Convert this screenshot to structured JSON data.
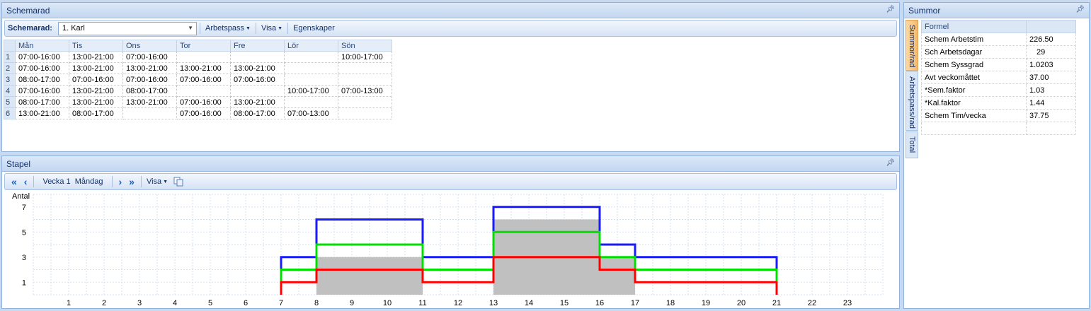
{
  "schemarad": {
    "title": "Schemarad",
    "toolbar": {
      "label": "Schemarad:",
      "combo_value": "1. Karl",
      "arbetspass": "Arbetspass",
      "visa": "Visa",
      "egenskaper": "Egenskaper"
    },
    "columns": [
      "Mån",
      "Tis",
      "Ons",
      "Tor",
      "Fre",
      "Lör",
      "Sön"
    ],
    "rows": [
      {
        "n": "1",
        "cells": [
          "07:00-16:00",
          "13:00-21:00",
          "07:00-16:00",
          "",
          "",
          "",
          "10:00-17:00"
        ]
      },
      {
        "n": "2",
        "cells": [
          "07:00-16:00",
          "13:00-21:00",
          "13:00-21:00",
          "13:00-21:00",
          "13:00-21:00",
          "",
          ""
        ]
      },
      {
        "n": "3",
        "cells": [
          "08:00-17:00",
          "07:00-16:00",
          "07:00-16:00",
          "07:00-16:00",
          "07:00-16:00",
          "",
          ""
        ]
      },
      {
        "n": "4",
        "cells": [
          "07:00-16:00",
          "13:00-21:00",
          "08:00-17:00",
          "",
          "",
          "10:00-17:00",
          "07:00-13:00"
        ]
      },
      {
        "n": "5",
        "cells": [
          "08:00-17:00",
          "13:00-21:00",
          "13:00-21:00",
          "07:00-16:00",
          "13:00-21:00",
          "",
          ""
        ]
      },
      {
        "n": "6",
        "cells": [
          "13:00-21:00",
          "08:00-17:00",
          "",
          "07:00-16:00",
          "08:00-17:00",
          "07:00-13:00",
          ""
        ]
      }
    ]
  },
  "stapel": {
    "title": "Stapel",
    "week_label": "Vecka 1",
    "day_label": "Måndag",
    "visa": "Visa"
  },
  "summor": {
    "title": "Summor",
    "tabs": [
      "Summor/rad",
      "Arbetspass/rad",
      "Total"
    ],
    "header": "Formel",
    "rows": [
      {
        "label": "Schem Arbetstim",
        "value": "226.50"
      },
      {
        "label": "Sch Arbetsdagar",
        "value": "29"
      },
      {
        "label": "Schem Syssgrad",
        "value": "1.0203"
      },
      {
        "label": "Avt veckomåttet",
        "value": "37.00"
      },
      {
        "label": "*Sem.faktor",
        "value": "1.03"
      },
      {
        "label": "*Kal.faktor",
        "value": "1.44"
      },
      {
        "label": "Schem Tim/vecka",
        "value": "37.75"
      }
    ]
  },
  "chart_data": {
    "type": "line",
    "ylabel": "Antal",
    "y_ticks": [
      1,
      3,
      5,
      7
    ],
    "ylim": [
      0,
      8
    ],
    "x_ticks": [
      1,
      2,
      3,
      4,
      5,
      6,
      7,
      8,
      9,
      10,
      11,
      12,
      13,
      14,
      15,
      16,
      17,
      18,
      19,
      20,
      21,
      22,
      23
    ],
    "xlim": [
      0,
      24
    ],
    "step": true,
    "grid": true,
    "filled": {
      "color": "#c0c0c0",
      "x": [
        7,
        8,
        11,
        13,
        16,
        17,
        21
      ],
      "values": [
        0,
        3,
        0,
        6,
        3,
        0,
        0
      ]
    },
    "series": [
      {
        "color": "#1a1aff",
        "x": [
          7,
          8,
          11,
          13,
          16,
          17,
          21
        ],
        "values": [
          3,
          6,
          3,
          7,
          4,
          3,
          0
        ]
      },
      {
        "color": "#00e000",
        "x": [
          7,
          8,
          11,
          13,
          16,
          17,
          21
        ],
        "values": [
          2,
          4,
          2,
          5,
          3,
          2,
          0
        ]
      },
      {
        "color": "#ff0000",
        "x": [
          7,
          8,
          11,
          13,
          16,
          17,
          21
        ],
        "values": [
          1,
          2,
          1,
          3,
          2,
          1,
          0
        ]
      }
    ]
  }
}
